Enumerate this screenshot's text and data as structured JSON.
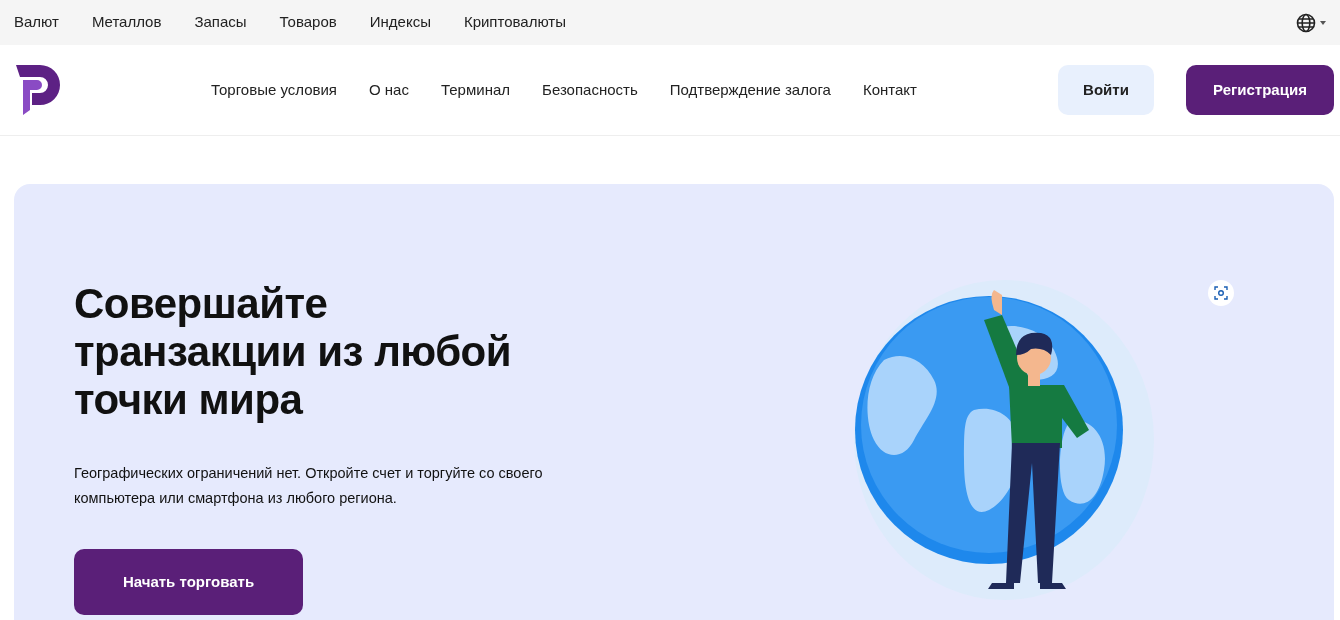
{
  "top_bar": {
    "links": [
      "Валют",
      "Металлов",
      "Запасы",
      "Товаров",
      "Индексы",
      "Криптовалюты"
    ]
  },
  "navbar": {
    "items": [
      "Торговые условия",
      "О нас",
      "Терминал",
      "Безопасность",
      "Подтверждение залога",
      "Контакт"
    ],
    "login": "Войти",
    "register": "Регистрация"
  },
  "hero": {
    "title": "Совершайте транзакции из любой точки мира",
    "text": "Географических ограничений нет. Откройте счет и торгуйте со своего компьютера или смартфона из любого региона.",
    "cta": "Начать торговать"
  }
}
